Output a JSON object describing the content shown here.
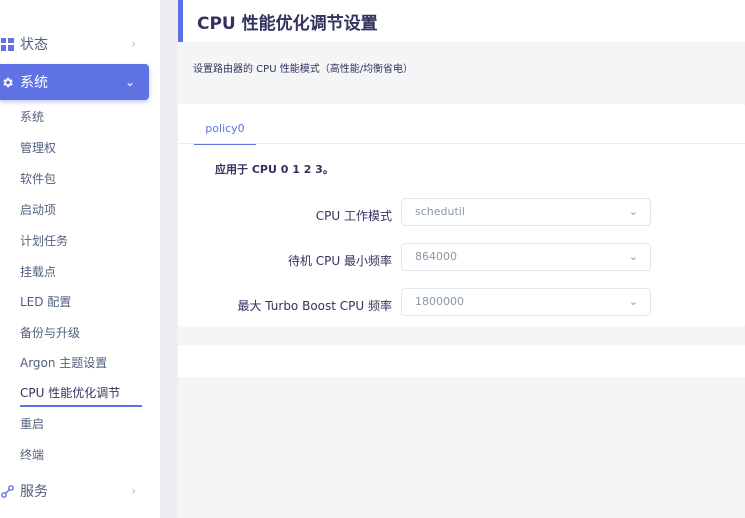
{
  "sidebar": {
    "status": {
      "label": "状态",
      "icon": "grid-icon"
    },
    "system": {
      "label": "系统",
      "icon": "gear-icon"
    },
    "sub_items": [
      "系统",
      "管理权",
      "软件包",
      "启动项",
      "计划任务",
      "挂载点",
      "LED 配置",
      "备份与升级",
      "Argon 主题设置",
      "CPU 性能优化调节",
      "重启",
      "终端"
    ],
    "active_sub": "CPU 性能优化调节",
    "services": {
      "label": "服务",
      "icon": "share-icon"
    }
  },
  "page": {
    "title": "CPU 性能优化调节设置",
    "description": "设置路由器的 CPU 性能模式（高性能/均衡省电）"
  },
  "tabs": [
    {
      "label": "policy0"
    }
  ],
  "section": {
    "applies_to": "应用于 CPU 0 1 2 3。",
    "fields": [
      {
        "label": "CPU 工作模式",
        "value": "schedutil"
      },
      {
        "label": "待机 CPU 最小频率",
        "value": "864000"
      },
      {
        "label": "最大 Turbo Boost CPU 频率",
        "value": "1800000"
      }
    ]
  },
  "colors": {
    "accent": "#5e72e4"
  }
}
